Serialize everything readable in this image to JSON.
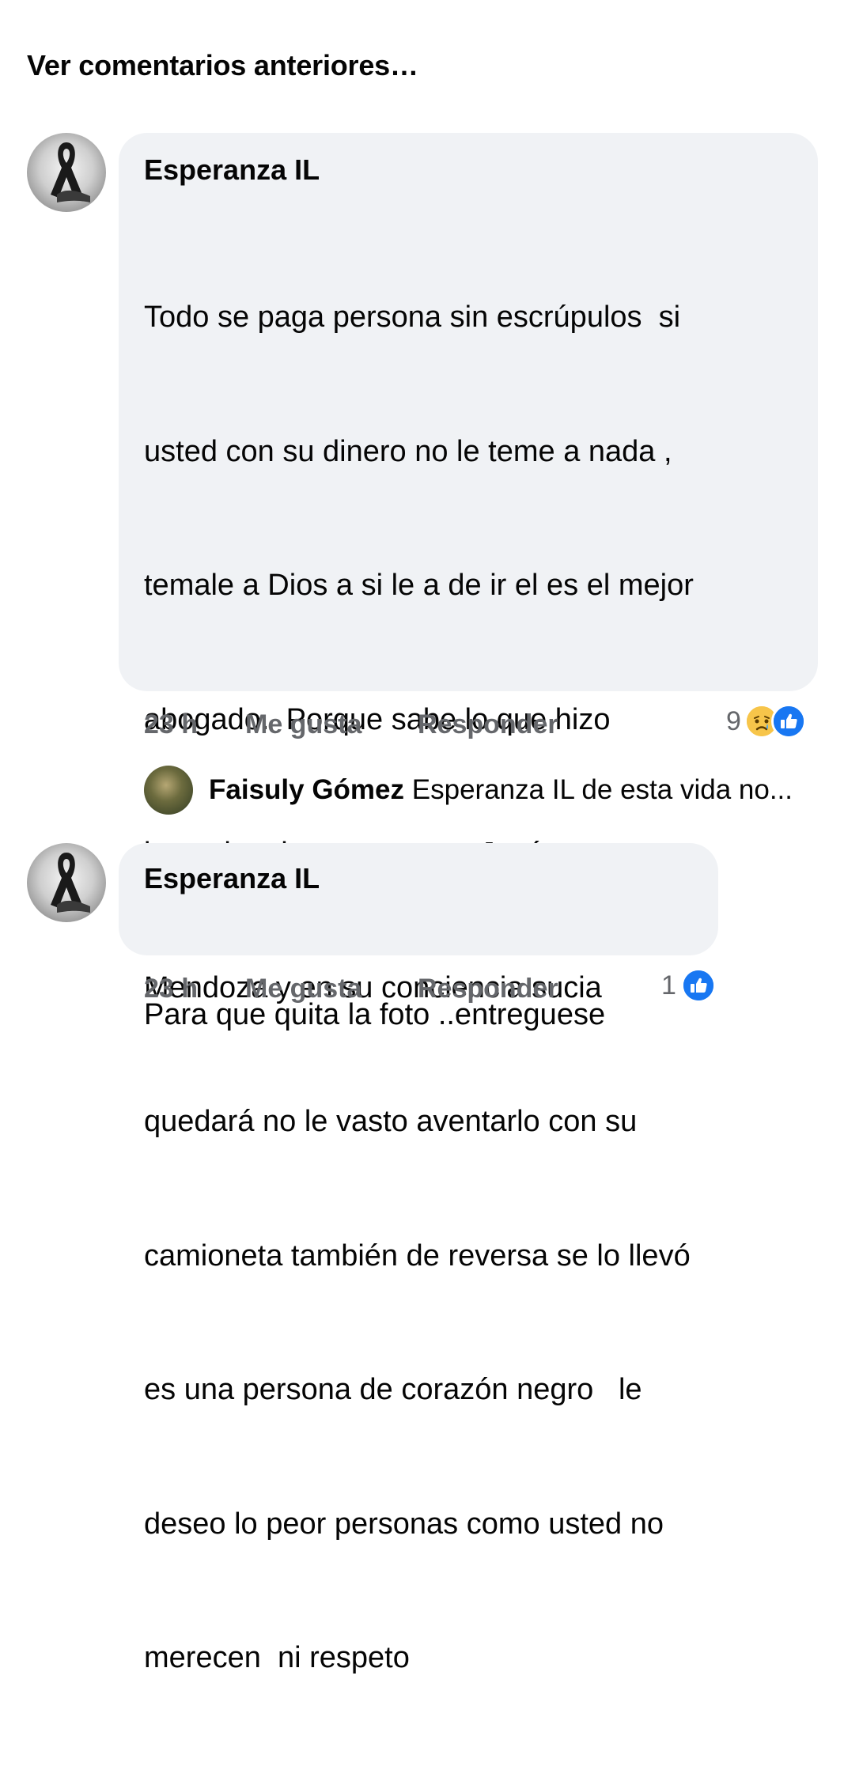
{
  "previous_comments_link": "Ver comentarios anteriores…",
  "comments": [
    {
      "author": "Esperanza IL",
      "lines": [
        "Todo se paga persona sin escrúpulos  si",
        "usted con su dinero no le teme a nada ,",
        "temale a Dios a si le a de ir el es el mejor",
        "abogado.  Porque sabe lo que hizo",
        "intencionalmente mato a Jesús",
        "Mendoza y en su conciencia sucia",
        "quedará no le vasto aventarlo con su",
        "camioneta también de reversa se lo llevó",
        "es una persona de corazón negro   le",
        "deseo lo peor personas como usted no",
        "merecen  ni respeto"
      ],
      "time": "23 h",
      "like_label": "Me gusta",
      "reply_label": "Responder",
      "reaction_count": "9",
      "reaction_icons": [
        "sad-icon",
        "like-icon"
      ]
    },
    {
      "author": "Esperanza IL",
      "lines": [
        "Para que quita la foto ..entreguese"
      ],
      "time": "23 h",
      "like_label": "Me gusta",
      "reply_label": "Responder",
      "reaction_count": "1",
      "reaction_icons": [
        "like-icon"
      ]
    }
  ],
  "reply_preview": {
    "author": "Faisuly Gómez",
    "text": "Esperanza IL de esta vida no..."
  },
  "colors": {
    "bubble": "#f0f2f5",
    "meta_text": "#65676b",
    "like_blue": "#1877f2",
    "sad_yellow": "#f7c54a"
  }
}
